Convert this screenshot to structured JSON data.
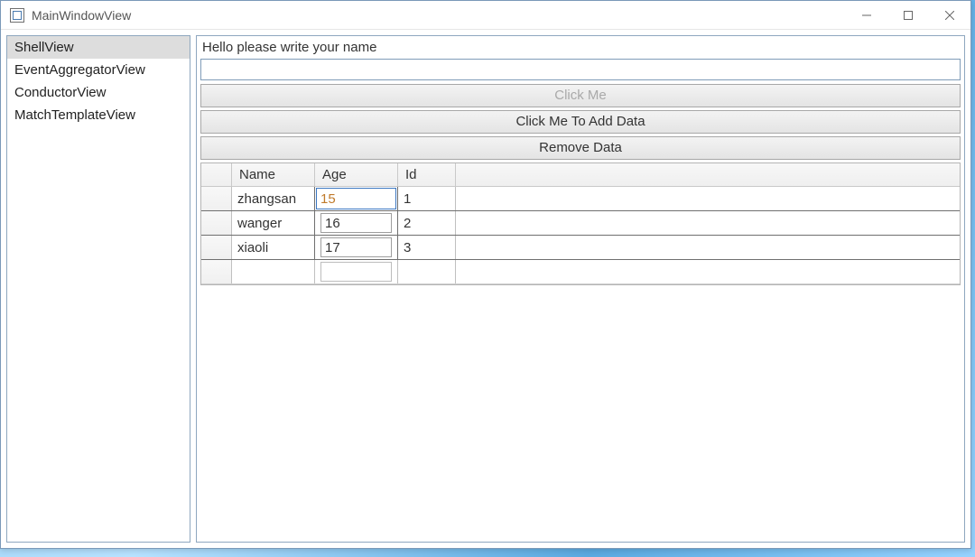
{
  "window": {
    "title": "MainWindowView"
  },
  "sidebar": {
    "items": [
      {
        "label": "ShellView",
        "selected": true
      },
      {
        "label": "EventAggregatorView",
        "selected": false
      },
      {
        "label": "ConductorView",
        "selected": false
      },
      {
        "label": "MatchTemplateView",
        "selected": false
      }
    ]
  },
  "main": {
    "prompt": "Hello please write your name",
    "name_value": "",
    "buttons": {
      "click_me": "Click Me",
      "add_data": "Click Me To Add Data",
      "remove_data": "Remove Data"
    },
    "grid": {
      "columns": {
        "name": "Name",
        "age": "Age",
        "id": "Id"
      },
      "rows": [
        {
          "name": "zhangsan",
          "age": "15",
          "id": "1",
          "editing_age": true
        },
        {
          "name": "wanger",
          "age": "16",
          "id": "2",
          "editing_age": false
        },
        {
          "name": "xiaoli",
          "age": "17",
          "id": "3",
          "editing_age": false
        }
      ]
    }
  }
}
